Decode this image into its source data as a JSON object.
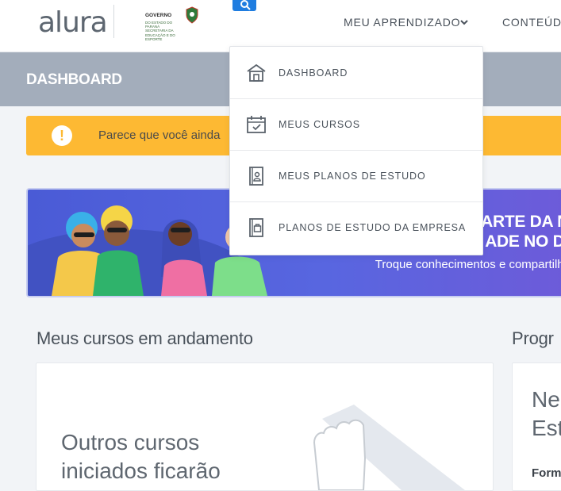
{
  "header": {
    "logo": "alura",
    "partner_logo": {
      "title": "GOVERNO",
      "subtitle": "DO ESTADO DO PARANÁ",
      "dept": "SECRETARIA DA EDUCAÇÃO E DO ESPORTE"
    },
    "nav": {
      "learning_label": "MEU APRENDIZADO",
      "content_label": "CONTEÚDO"
    },
    "icons": {
      "search": "search-icon",
      "dropdown": "chevron-down-icon"
    }
  },
  "page_title": "DASHBOARD",
  "warning": {
    "icon": "exclamation-icon",
    "text": "Parece que você ainda"
  },
  "banner": {
    "headline_line1": "ARTE DA N",
    "headline_line2": "ADE NO DI",
    "subtitle": "Troque conhecimentos e compartilhe"
  },
  "courses_section": {
    "title": "Meus cursos em andamento",
    "empty_text": "Outros cursos iniciados ficarão"
  },
  "progress_section": {
    "title": "Progr",
    "card_text_line1": "Ne",
    "card_text_line2": "Est",
    "card_label": "Form"
  },
  "dropdown": {
    "items": [
      {
        "label": "DASHBOARD",
        "icon": "home-icon"
      },
      {
        "label": "MEUS CURSOS",
        "icon": "calendar-check-icon"
      },
      {
        "label": "MEUS PLANOS DE ESTUDO",
        "icon": "study-plan-icon"
      },
      {
        "label": "PLANOS DE ESTUDO DA EMPRESA",
        "icon": "company-plan-icon"
      }
    ]
  },
  "colors": {
    "brand_blue": "#1f7de0",
    "title_bar": "#a3adbb",
    "warning": "#fdb933",
    "banner": "#5866e0"
  }
}
